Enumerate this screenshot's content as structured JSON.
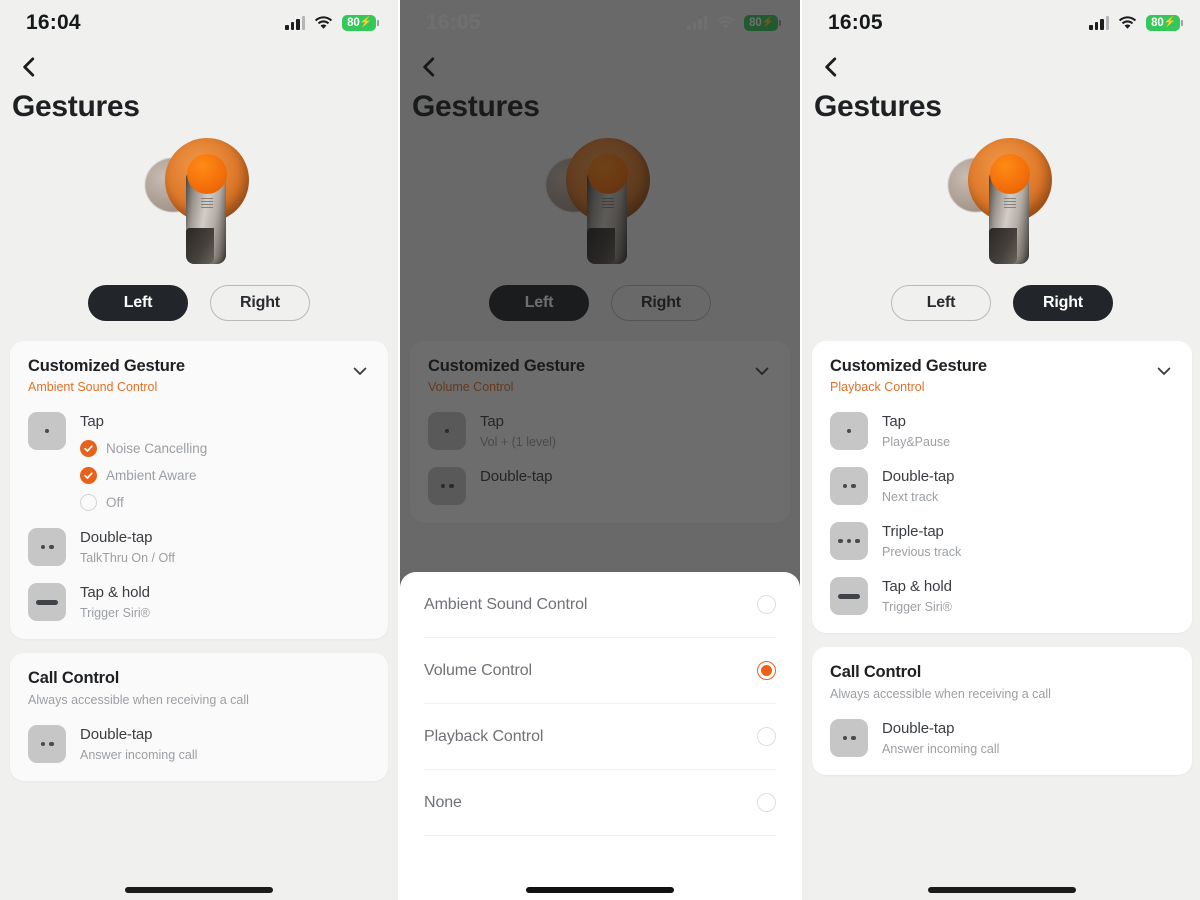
{
  "panels": [
    {
      "id": "panel-left-earbud",
      "status": {
        "time": "16:04",
        "battery": "80",
        "battery_icon": "battery-charging-icon",
        "wifi_icon": "wifi-icon",
        "signal_icon": "cellular-signal-icon"
      },
      "back_icon": "back-chevron-icon",
      "title": "Gestures",
      "product_image": "earbud-product-image",
      "toggle": {
        "left": "Left",
        "right": "Right",
        "selected": "Left"
      },
      "cards": [
        {
          "title": "Customized Gesture",
          "subtitle": "Ambient Sound Control",
          "subtitle_color": "#e1722a",
          "chevron_icon": "chevron-down-icon",
          "rows": [
            {
              "icon": "single-tap-icon",
              "dots": 1,
              "name": "Tap",
              "sub": "",
              "options": [
                {
                  "label": "Noise Cancelling",
                  "checked": true
                },
                {
                  "label": "Ambient Aware",
                  "checked": true
                },
                {
                  "label": "Off",
                  "checked": false
                }
              ]
            },
            {
              "icon": "double-tap-icon",
              "dots": 2,
              "name": "Double-tap",
              "sub": "TalkThru On / Off",
              "options": []
            },
            {
              "icon": "tap-hold-icon",
              "dots": 0,
              "name": "Tap & hold",
              "sub": "Trigger Siri®",
              "options": []
            }
          ]
        },
        {
          "title": "Call Control",
          "subtitle": "Always accessible when receiving a call",
          "subtitle_color": "#9b9fa3",
          "chevron_icon": "",
          "rows": [
            {
              "icon": "double-tap-icon",
              "dots": 2,
              "name": "Double-tap",
              "sub": "Answer incoming call",
              "options": []
            }
          ]
        }
      ]
    },
    {
      "id": "panel-selection-sheet",
      "dimmed": true,
      "status": {
        "time": "16:05",
        "battery": "80",
        "battery_icon": "battery-charging-icon",
        "wifi_icon": "wifi-icon",
        "signal_icon": "cellular-signal-icon"
      },
      "back_icon": "back-chevron-icon",
      "title": "Gestures",
      "product_image": "earbud-product-image",
      "toggle": {
        "left": "Left",
        "right": "Right",
        "selected": "Left"
      },
      "cards": [
        {
          "title": "Customized Gesture",
          "subtitle": "Volume Control",
          "subtitle_color": "#e1722a",
          "chevron_icon": "chevron-down-icon",
          "rows": [
            {
              "icon": "single-tap-icon",
              "dots": 1,
              "name": "Tap",
              "sub": "Vol + (1 level)",
              "options": []
            },
            {
              "icon": "double-tap-icon",
              "dots": 2,
              "name": "Double-tap",
              "sub": "",
              "options": []
            }
          ]
        }
      ],
      "sheet": {
        "options": [
          {
            "label": "Ambient Sound Control",
            "selected": false
          },
          {
            "label": "Volume Control",
            "selected": true
          },
          {
            "label": "Playback Control",
            "selected": false
          },
          {
            "label": "None",
            "selected": false
          }
        ]
      }
    },
    {
      "id": "panel-right-earbud",
      "status": {
        "time": "16:05",
        "battery": "80",
        "battery_icon": "battery-charging-icon",
        "wifi_icon": "wifi-icon",
        "signal_icon": "cellular-signal-icon"
      },
      "back_icon": "back-chevron-icon",
      "title": "Gestures",
      "product_image": "earbud-product-image",
      "toggle": {
        "left": "Left",
        "right": "Right",
        "selected": "Right"
      },
      "cards": [
        {
          "title": "Customized Gesture",
          "subtitle": "Playback Control",
          "subtitle_color": "#e1722a",
          "chevron_icon": "chevron-down-icon",
          "rows": [
            {
              "icon": "single-tap-icon",
              "dots": 1,
              "name": "Tap",
              "sub": "Play&Pause",
              "options": []
            },
            {
              "icon": "double-tap-icon",
              "dots": 2,
              "name": "Double-tap",
              "sub": "Next track",
              "options": []
            },
            {
              "icon": "triple-tap-icon",
              "dots": 3,
              "name": "Triple-tap",
              "sub": "Previous track",
              "options": []
            },
            {
              "icon": "tap-hold-icon",
              "dots": 0,
              "name": "Tap & hold",
              "sub": "Trigger Siri®",
              "options": []
            }
          ]
        },
        {
          "title": "Call Control",
          "subtitle": "Always accessible when receiving a call",
          "subtitle_color": "#9b9fa3",
          "chevron_icon": "",
          "rows": [
            {
              "icon": "double-tap-icon",
              "dots": 2,
              "name": "Double-tap",
              "sub": "Answer incoming call",
              "options": []
            }
          ]
        }
      ]
    }
  ],
  "colors": {
    "accent_orange": "#e8621d",
    "pill_active_bg": "#22262b",
    "battery_green": "#34c759",
    "page_bg": "#f0f0ef",
    "card_bg": "#fafafa"
  }
}
